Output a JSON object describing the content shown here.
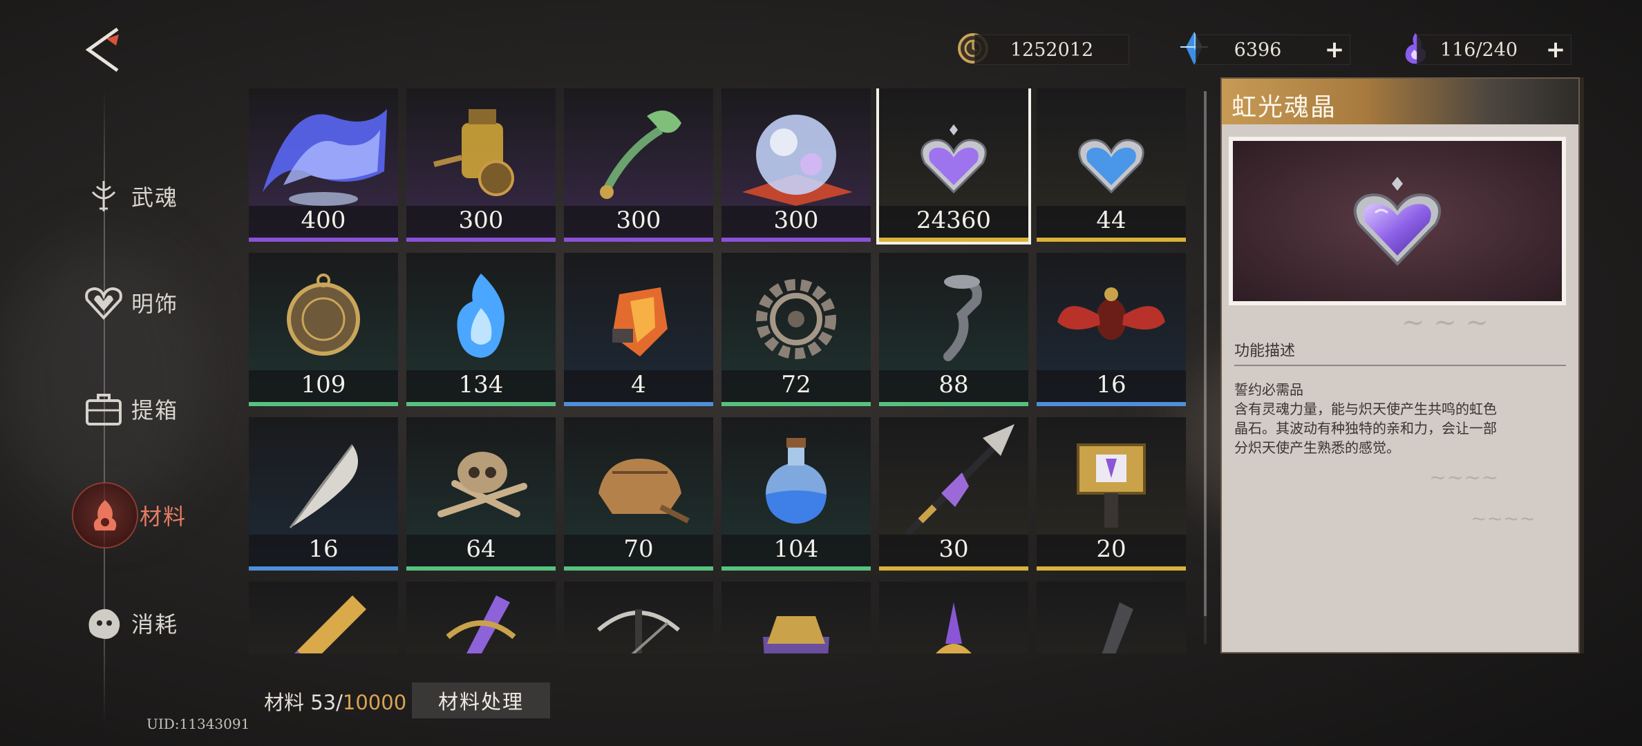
{
  "nav": {
    "items": [
      {
        "label": "武魂",
        "icon": "soul-weapon-icon"
      },
      {
        "label": "明饰",
        "icon": "heart-ornament-icon"
      },
      {
        "label": "提箱",
        "icon": "suitcase-icon"
      },
      {
        "label": "材料",
        "icon": "materials-icon",
        "active": true
      },
      {
        "label": "消耗",
        "icon": "consumables-icon"
      }
    ]
  },
  "currencies": {
    "gold": {
      "value": "1252012",
      "icon": "gold-coin-icon"
    },
    "crystal": {
      "value": "6396",
      "icon": "blue-crystal-icon"
    },
    "stamina": {
      "value": "116/240",
      "icon": "purple-flame-icon"
    }
  },
  "rarity_colors": {
    "purple": "#8a52d6",
    "gold": "#d9b23a",
    "green": "#56c27e",
    "blue": "#4f8fd8"
  },
  "items": [
    {
      "name": "aurora",
      "count": "400",
      "rarity": "purple"
    },
    {
      "name": "brass-lamp",
      "count": "300",
      "rarity": "purple"
    },
    {
      "name": "jade-scepter",
      "count": "300",
      "rarity": "purple"
    },
    {
      "name": "crystal-orb",
      "count": "300",
      "rarity": "purple"
    },
    {
      "name": "rainbow-soul-crystal",
      "count": "24360",
      "rarity": "gold",
      "selected": true
    },
    {
      "name": "blue-heart-crystal",
      "count": "44",
      "rarity": "gold"
    },
    {
      "name": "pocket-watch",
      "count": "109",
      "rarity": "green"
    },
    {
      "name": "blue-flame",
      "count": "134",
      "rarity": "green"
    },
    {
      "name": "amber-shard",
      "count": "4",
      "rarity": "blue"
    },
    {
      "name": "gear",
      "count": "72",
      "rarity": "green"
    },
    {
      "name": "iron-hook",
      "count": "88",
      "rarity": "green"
    },
    {
      "name": "red-beetle",
      "count": "16",
      "rarity": "blue"
    },
    {
      "name": "feather",
      "count": "16",
      "rarity": "blue"
    },
    {
      "name": "skull-bones",
      "count": "64",
      "rarity": "green"
    },
    {
      "name": "leather-pouch",
      "count": "70",
      "rarity": "green"
    },
    {
      "name": "potion-flask",
      "count": "104",
      "rarity": "green"
    },
    {
      "name": "ornate-spear",
      "count": "30",
      "rarity": "gold"
    },
    {
      "name": "golden-hammer",
      "count": "20",
      "rarity": "gold"
    },
    {
      "name": "golden-bullet",
      "count": "",
      "rarity": "gold"
    },
    {
      "name": "purple-bolt",
      "count": "",
      "rarity": "gold"
    },
    {
      "name": "crossbow",
      "count": "",
      "rarity": "gold"
    },
    {
      "name": "crystal-gauntlet",
      "count": "",
      "rarity": "gold"
    },
    {
      "name": "gold-blade",
      "count": "",
      "rarity": "gold"
    },
    {
      "name": "dark-dagger",
      "count": "",
      "rarity": "gold"
    }
  ],
  "detail": {
    "title": "虹光魂晶",
    "section": "功能描述",
    "lines": [
      "誓约必需品",
      "含有灵魂力量，能与炽天使产生共鸣的虹色",
      "晶石。其波动有种独特的亲和力，会让一部",
      "分炽天使产生熟悉的感觉。"
    ]
  },
  "footer": {
    "mat_label": "材料 53/",
    "mat_cap": "10000",
    "process_button": "材料处理",
    "uid": "UID:11343091"
  }
}
